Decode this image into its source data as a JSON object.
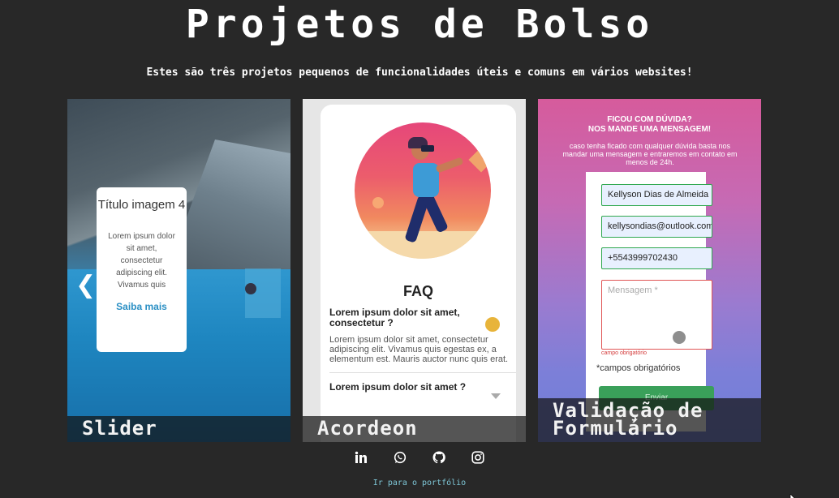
{
  "header": {
    "title": "Projetos de Bolso",
    "subtitle": "Estes são três projetos pequenos de funcionalidades úteis e comuns em vários websites!"
  },
  "cards": [
    {
      "caption": "Slider",
      "slide": {
        "title": "Título imagem 4",
        "text": "Lorem ipsum dolor sit amet, consectetur adipiscing elit. Vivamus quis",
        "link": "Saiba mais"
      }
    },
    {
      "caption": "Acordeon",
      "faq": {
        "title": "FAQ",
        "q1": "Lorem ipsum dolor sit amet, consectetur ?",
        "a1": "Lorem ipsum dolor sit amet, consectetur adipiscing elit. Vivamus quis egestas ex, a elementum est. Mauris auctor nunc quis erat.",
        "q2": "Lorem ipsum dolor sit amet ?"
      }
    },
    {
      "caption": "Validação de Formulário",
      "form": {
        "heading_line1": "FICOU COM DÚVIDA?",
        "heading_line2": "NOS MANDE UMA MENSAGEM!",
        "description": "caso tenha ficado com qualquer dúvida basta nos mandar uma mensagem e entraremos em contato em menos de 24h.",
        "name_value": "Kellyson Dias de Almeida",
        "email_value": "kellysondias@outlook.com",
        "phone_value": "+5543999702430",
        "message_placeholder": "Mensagem *",
        "error_text": "campo obrigatório",
        "required_note": "*campos obrigatórios",
        "submit_label": "Enviar"
      }
    }
  ],
  "footer": {
    "social_icons": [
      "linkedin-icon",
      "whatsapp-icon",
      "github-icon",
      "instagram-icon"
    ],
    "portfolio_link": "Ir para o portfólio"
  },
  "colors": {
    "background": "#282828",
    "link": "#7ec6d6"
  }
}
